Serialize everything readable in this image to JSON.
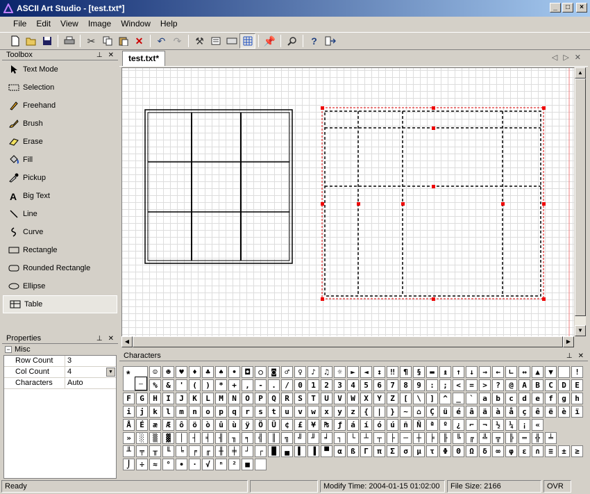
{
  "window": {
    "title": "ASCII Art Studio - [test.txt*]",
    "controls": [
      "_",
      "□",
      "×"
    ]
  },
  "menu": [
    "File",
    "Edit",
    "View",
    "Image",
    "Window",
    "Help"
  ],
  "toolbar": [
    "new-icon",
    "open-icon",
    "save-icon",
    "|",
    "print-icon",
    "|",
    "cut-icon",
    "copy-icon",
    "paste-icon",
    "delete-icon",
    "|",
    "undo-icon",
    "redo-icon",
    "|",
    "tools-icon",
    "properties-icon",
    "keyboard-icon",
    "grid-icon",
    "|",
    "pin-icon",
    "|",
    "zoom-icon",
    "|",
    "help-icon",
    "exit-icon"
  ],
  "toolbox": {
    "title": "Toolbox",
    "tools": [
      {
        "label": "Text Mode",
        "icon": "arrow-icon"
      },
      {
        "label": "Selection",
        "icon": "selection-icon"
      },
      {
        "label": "Freehand",
        "icon": "pencil-icon"
      },
      {
        "label": "Brush",
        "icon": "brush-icon"
      },
      {
        "label": "Erase",
        "icon": "eraser-icon"
      },
      {
        "label": "Fill",
        "icon": "fill-icon"
      },
      {
        "label": "Pickup",
        "icon": "pickup-icon"
      },
      {
        "label": "Big Text",
        "icon": "big-text-icon"
      },
      {
        "label": "Line",
        "icon": "line-icon"
      },
      {
        "label": "Curve",
        "icon": "curve-icon"
      },
      {
        "label": "Rectangle",
        "icon": "rectangle-icon"
      },
      {
        "label": "Rounded Rectangle",
        "icon": "rounded-rectangle-icon"
      },
      {
        "label": "Ellipse",
        "icon": "ellipse-icon"
      },
      {
        "label": "Table",
        "icon": "table-icon"
      }
    ],
    "selected": "Table"
  },
  "properties": {
    "title": "Properties",
    "category": "Misc",
    "rows": [
      {
        "key": "Row Count",
        "value": "3"
      },
      {
        "key": "Col Count",
        "value": "4"
      },
      {
        "key": "Characters",
        "value": "Auto"
      }
    ]
  },
  "document": {
    "tab": "test.txt*"
  },
  "characters": {
    "title": "Characters",
    "rows": [
      "☺☻♥♦♣♠•◘○◙♂♀♪♫☼►◄↕‼¶§▬↨↑↓→←∟↔▲▼ !\"#$",
      "%&'()*+,-./0123456789:;<=>?@ABCDE",
      "FGHIJKLMNOPQRSTUVWXYZ[\\]^_`abcdefgh",
      "ijklmnopqrstuvwxyz{|}~⌂ÇüéâäàåçêëèïîìÄ",
      "ÅÉæÆôöòûùÿÖÜ¢£¥₧ƒáíóúñÑªº¿⌐¬½¼¡«",
      "»░▒▓│┤╡╢╖╕╣║╗╝╜╛┐└┴┬├─┼╞╟╚╔╩╦╠═╬╧",
      "╨╤╥╙╘╒╓╫╪┘┌█▄▌▐▀αßΓπΣσµτΦΘΩδ∞φε∩≡±≥≤⌠",
      "⌡÷≈°∙·√ⁿ²■ "
    ]
  },
  "status": {
    "ready": "Ready",
    "modify_time": "Modify Time: 2004-01-15 01:02:00",
    "file_size": "File Size: 2166",
    "mode": "OVR"
  }
}
